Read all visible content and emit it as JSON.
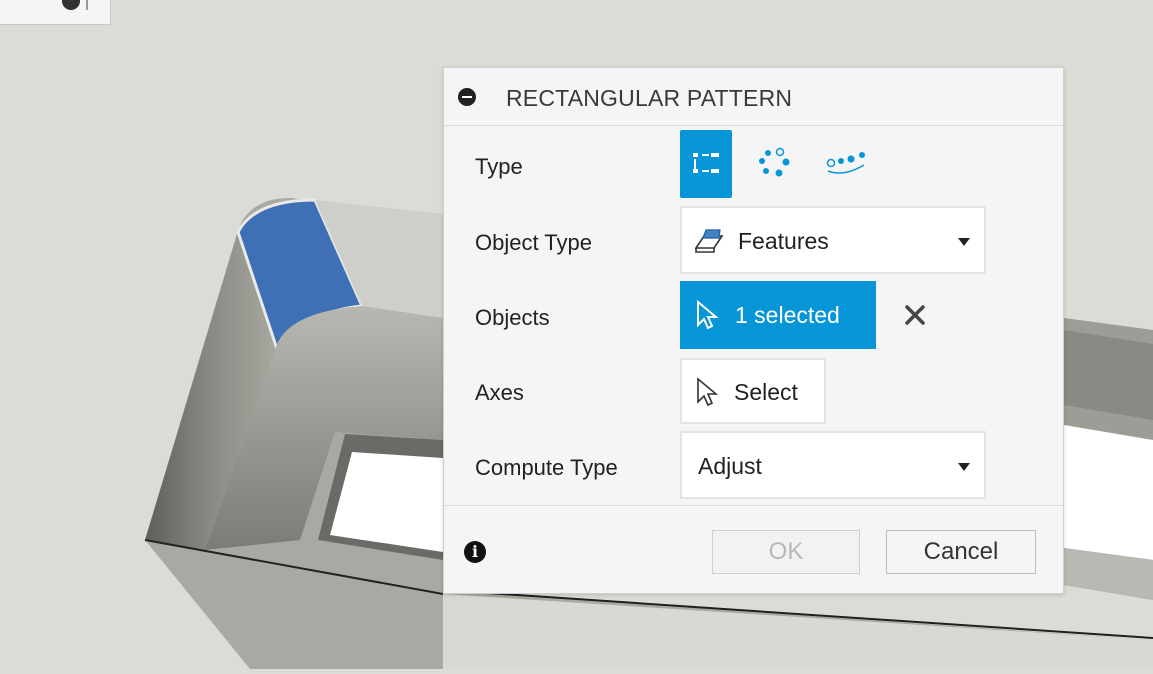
{
  "dialog": {
    "title": "RECTANGULAR PATTERN",
    "rows": {
      "type_label": "Type",
      "object_type_label": "Object Type",
      "objects_label": "Objects",
      "axes_label": "Axes",
      "compute_type_label": "Compute Type"
    },
    "type_options": [
      "rectangular-pattern-icon",
      "circular-pattern-icon",
      "path-pattern-icon"
    ],
    "type_selected": "rectangular-pattern-icon",
    "object_type_value": "Features",
    "objects_value": "1 selected",
    "axes_value": "Select",
    "compute_type_value": "Adjust",
    "ok_label": "OK",
    "cancel_label": "Cancel"
  },
  "colors": {
    "accent": "#0696d7",
    "face_highlight": "#3f6fb4",
    "background": "#dcdcd6"
  }
}
